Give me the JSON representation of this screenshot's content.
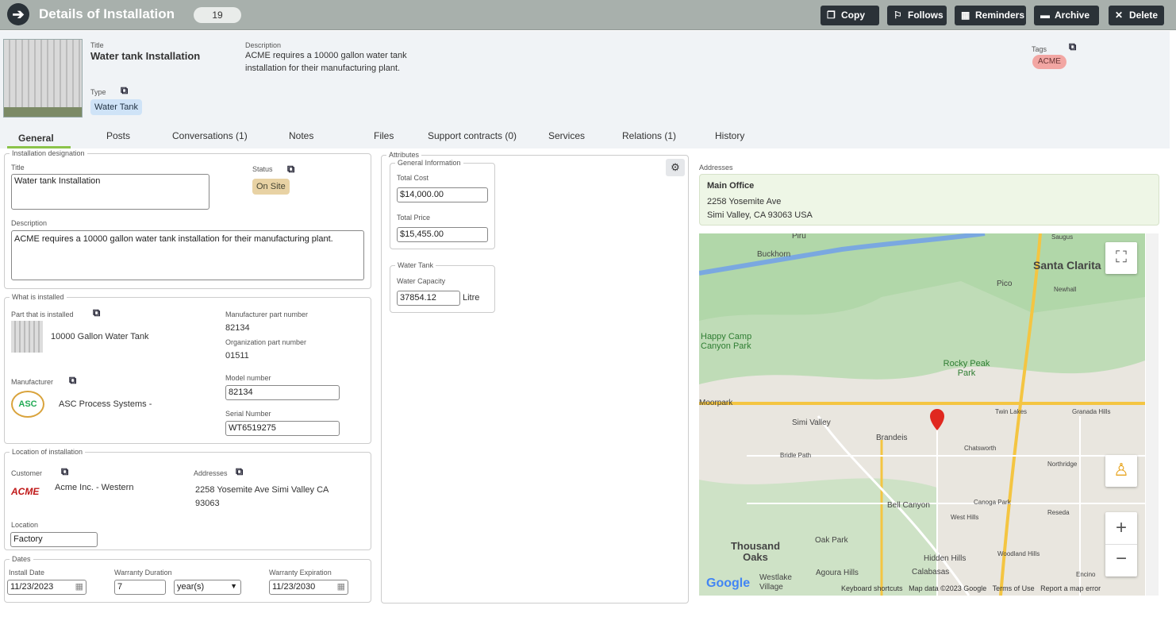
{
  "topbar": {
    "title": "Details of Installation",
    "count": "19",
    "buttons": [
      {
        "icon": "copy-icon",
        "label": "Copy"
      },
      {
        "icon": "follows-icon",
        "label": "Follows"
      },
      {
        "icon": "calendar-icon",
        "label": "Reminders"
      },
      {
        "icon": "archive-icon",
        "label": "Archive"
      },
      {
        "icon": "close-icon",
        "label": "Delete"
      }
    ]
  },
  "header": {
    "title_label": "Title",
    "title": "Water tank Installation",
    "desc_label": "Description",
    "description": "ACME requires a 10000 gallon water tank installation for their manufacturing plant.",
    "type_label": "Type",
    "type": "Water Tank",
    "tags_label": "Tags",
    "tag": "ACME"
  },
  "tabs": [
    "General",
    "Posts",
    "Conversations (1)",
    "Notes",
    "Files",
    "Support contracts (0)",
    "Services",
    "Relations (1)",
    "History"
  ],
  "designation": {
    "legend": "Installation designation",
    "title_label": "Title",
    "title": "Water tank Installation",
    "status_label": "Status",
    "status": "On Site",
    "desc_label": "Description",
    "description": "ACME requires a 10000 gallon water tank installation for their manufacturing plant."
  },
  "installed": {
    "legend": "What is installed",
    "part_label": "Part that is installed",
    "part": "10000 Gallon Water Tank",
    "mfr_part_label": "Manufacturer part number",
    "mfr_part": "82134",
    "org_part_label": "Organization part number",
    "org_part": "01511",
    "manufacturer_label": "Manufacturer",
    "manufacturer": "ASC Process Systems -",
    "manufacturer_logo": "ASC",
    "model_label": "Model number",
    "model": "82134",
    "serial_label": "Serial Number",
    "serial": "WT6519275"
  },
  "location": {
    "legend": "Location of installation",
    "customer_label": "Customer",
    "customer": "Acme Inc. - Western",
    "customer_logo": "ACME",
    "addresses_label": "Addresses",
    "address": "2258 Yosemite Ave Simi Valley CA 93063",
    "location_label": "Location",
    "location": "Factory"
  },
  "dates": {
    "legend": "Dates",
    "install_label": "Install Date",
    "install": "11/23/2023",
    "warranty_label": "Warranty Duration",
    "warranty": "7",
    "warranty_unit": "year(s)",
    "expiry_label": "Warranty Expiration",
    "expiry": "11/23/2030"
  },
  "attributes": {
    "legend": "Attributes",
    "general_legend": "General Information",
    "cost_label": "Total Cost",
    "cost": "$14,000.00",
    "price_label": "Total Price",
    "price": "$15,455.00",
    "tank_legend": "Water Tank",
    "capacity_label": "Water Capacity",
    "capacity": "37854.12",
    "capacity_unit": "Litre"
  },
  "addresses": {
    "label": "Addresses",
    "name": "Main Office",
    "line1": "2258 Yosemite Ave",
    "line2": "Simi Valley, CA 93063 USA"
  },
  "map": {
    "places": [
      "Santa Clarita",
      "Buckhorn",
      "Piru",
      "Saugus",
      "Pico",
      "Newhall",
      "Happy Camp Canyon Park",
      "Rocky Peak Park",
      "Simi Valley",
      "Brandeis",
      "Twin Lakes",
      "Granada Hills",
      "Chatsworth",
      "Bridle Path",
      "Northridge",
      "Bell Canyon",
      "Canoga Park",
      "West Hills",
      "Reseda",
      "Thousand Oaks",
      "Oak Park",
      "Hidden Hills",
      "Woodland Hills",
      "Westlake Village",
      "Agoura Hills",
      "Calabasas",
      "Encino",
      "Moorpark"
    ],
    "logo": "Google",
    "footer": [
      "Keyboard shortcuts",
      "Map data ©2023 Google",
      "Terms of Use",
      "Report a map error"
    ]
  }
}
